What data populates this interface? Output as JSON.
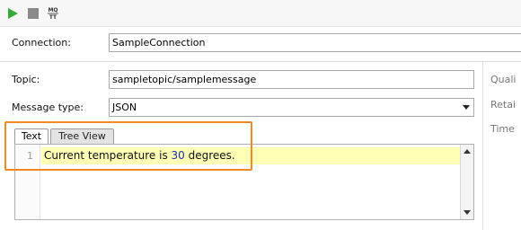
{
  "toolbar": {
    "play_icon": "play-icon",
    "stop_icon": "stop-icon",
    "mqtt_icon": "mqtt-icon",
    "mqtt_text": "MQTT",
    "play_color": "#3aa83a",
    "stop_color": "#8a8a8a"
  },
  "connection": {
    "label": "Connection:",
    "value": "SampleConnection"
  },
  "topic": {
    "label": "Topic:",
    "value": "sampletopic/samplemessage"
  },
  "message_type": {
    "label": "Message type:",
    "value": "JSON"
  },
  "right_panel": {
    "qual_label": "Quali",
    "retain_label": "Retai",
    "time_label": "Time"
  },
  "tabs": [
    {
      "label": "Text",
      "active": true
    },
    {
      "label": "Tree View",
      "active": false
    }
  ],
  "editor": {
    "line_number": "1",
    "text_before": "Current temperature is ",
    "number": "30",
    "text_after": " degrees."
  },
  "highlight_color": "#f08a24"
}
